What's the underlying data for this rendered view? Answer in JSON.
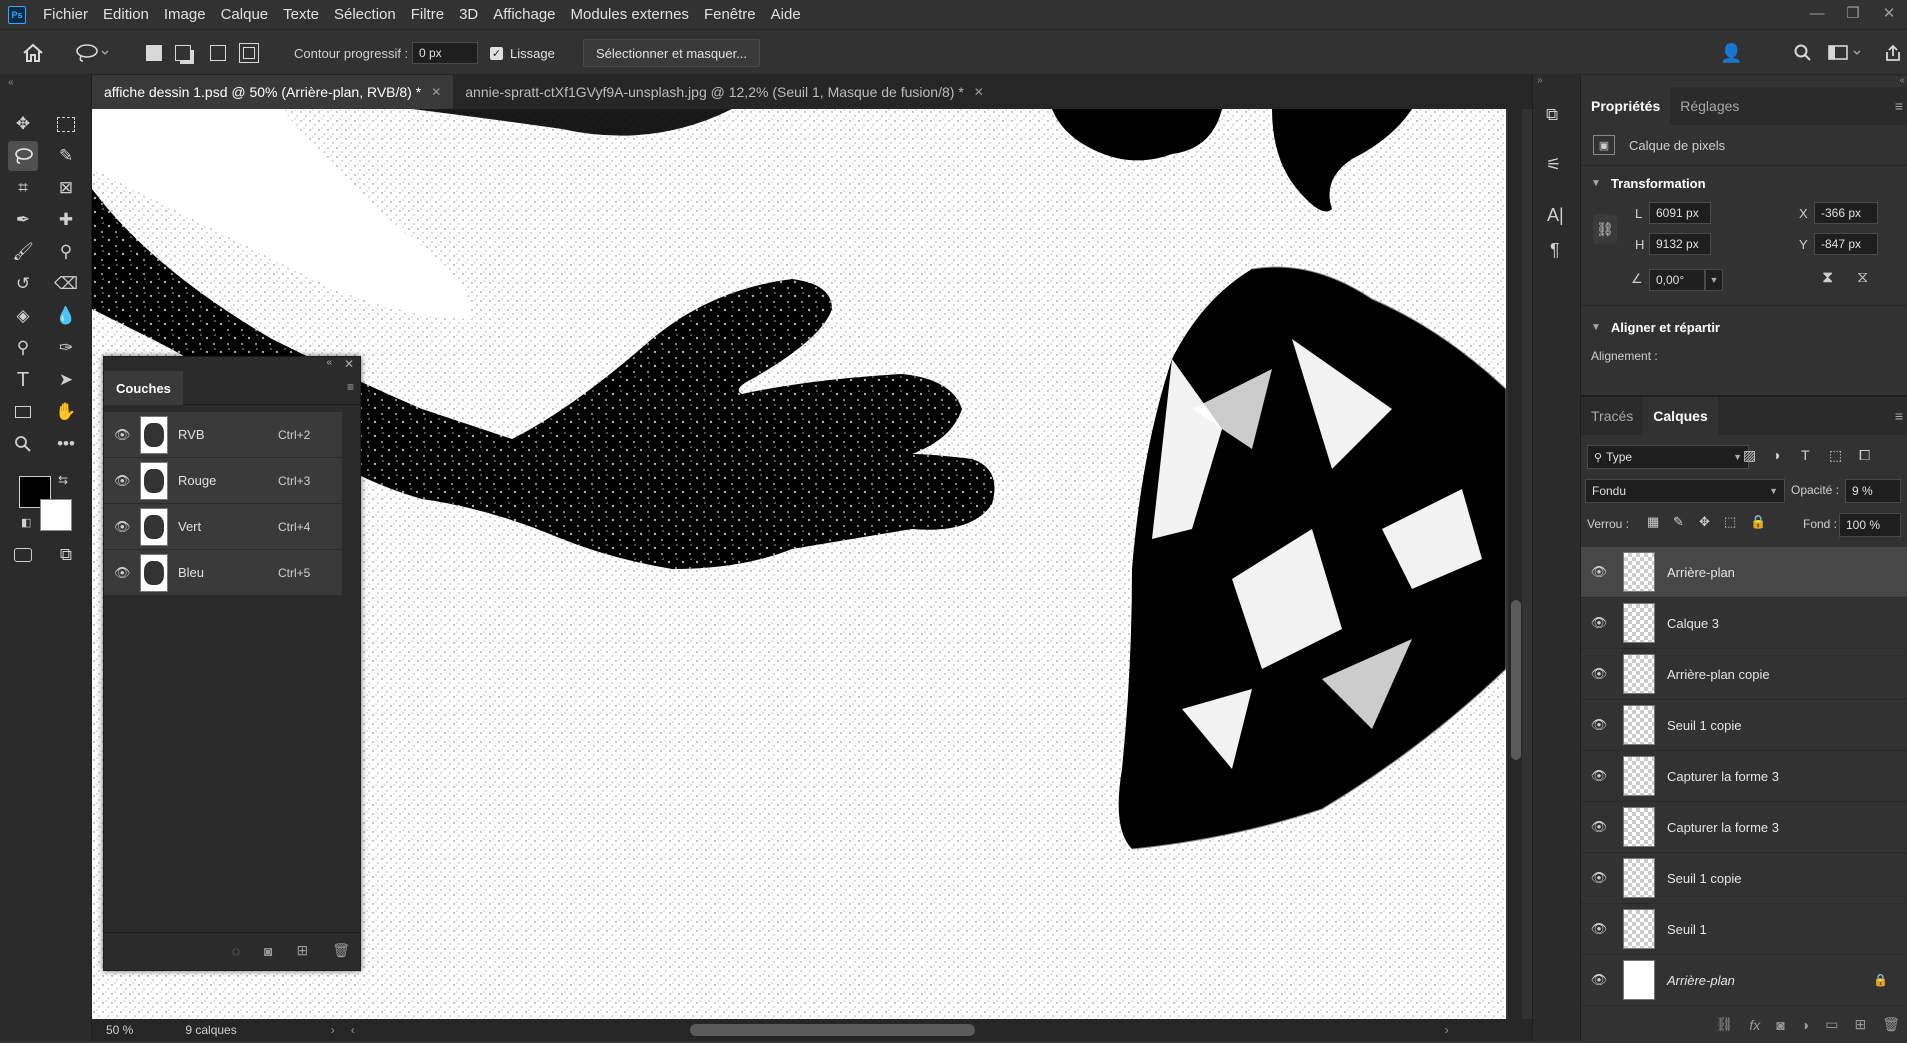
{
  "app": {
    "logo": "Ps"
  },
  "menu": [
    "Fichier",
    "Edition",
    "Image",
    "Calque",
    "Texte",
    "Sélection",
    "Filtre",
    "3D",
    "Affichage",
    "Modules externes",
    "Fenêtre",
    "Aide"
  ],
  "options": {
    "feather_label": "Contour progressif :",
    "feather_value": "0 px",
    "smoothing_label": "Lissage",
    "select_mask_label": "Sélectionner et masquer..."
  },
  "tabs": [
    {
      "label": "affiche dessin 1.psd @ 50% (Arrière-plan, RVB/8) *",
      "active": true
    },
    {
      "label": "annie-spratt-ctXf1GVyf9A-unsplash.jpg @ 12,2% (Seuil 1, Masque de fusion/8) *",
      "active": false
    }
  ],
  "status": {
    "zoom": "50 %",
    "layers_count": "9 calques"
  },
  "channels_panel": {
    "title": "Couches",
    "rows": [
      {
        "name": "RVB",
        "shortcut": "Ctrl+2"
      },
      {
        "name": "Rouge",
        "shortcut": "Ctrl+3"
      },
      {
        "name": "Vert",
        "shortcut": "Ctrl+4"
      },
      {
        "name": "Bleu",
        "shortcut": "Ctrl+5"
      }
    ]
  },
  "properties": {
    "tabs": [
      "Propriétés",
      "Réglages"
    ],
    "kind": "Calque de pixels",
    "transform_title": "Transformation",
    "w_label": "L",
    "w_value": "6091 px",
    "h_label": "H",
    "h_value": "9132 px",
    "x_label": "X",
    "x_value": "-366 px",
    "y_label": "Y",
    "y_value": "-847 px",
    "angle_value": "0,00°",
    "align_title": "Aligner et répartir",
    "align_label": "Alignement :"
  },
  "layers_panel": {
    "tabs": [
      "Tracés",
      "Calques"
    ],
    "filter": "Type",
    "blend_mode": "Fondu",
    "opacity_label": "Opacité :",
    "opacity_value": "9 %",
    "lock_label": "Verrou :",
    "fill_label": "Fond :",
    "fill_value": "100 %",
    "layers": [
      {
        "name": "Arrière-plan",
        "selected": true
      },
      {
        "name": "Calque 3",
        "selected": false
      },
      {
        "name": "Arrière-plan copie",
        "selected": false
      },
      {
        "name": "Seuil 1 copie",
        "selected": false
      },
      {
        "name": "Capturer la forme 3",
        "selected": false
      },
      {
        "name": "Capturer la forme 3",
        "selected": false
      },
      {
        "name": "Seuil 1 copie",
        "selected": false
      },
      {
        "name": "Seuil 1",
        "selected": false
      },
      {
        "name": "Arrière-plan",
        "selected": false,
        "locked": true
      }
    ]
  },
  "colors": {
    "accent": "#31a8ff",
    "bg": "#323232",
    "panel_dark": "#2b2b2b"
  }
}
